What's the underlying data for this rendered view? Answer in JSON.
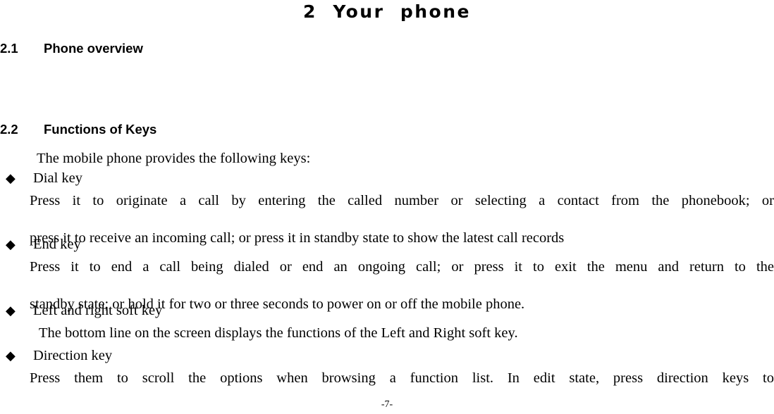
{
  "document": {
    "chapter_title": "2  Your  phone",
    "footer_page_number": "-7-"
  },
  "sections": {
    "overview": {
      "number": "2.1",
      "title": "Phone overview",
      "body": ""
    },
    "functions": {
      "number": "2.2",
      "title": "Functions of Keys",
      "intro": "The mobile phone provides the following keys:"
    }
  },
  "bullets": {
    "marker": "◆",
    "dial": {
      "label": "Dial key",
      "line1": "Press it to originate a call by entering the called number or selecting a contact from the phonebook; or",
      "line2": "press it to receive an incoming call; or press it in standby state to show the latest call records"
    },
    "end": {
      "label": "End key",
      "line1": "Press it to end a call being dialed or end an ongoing call; or press it to exit the menu and return to the",
      "line2": "standby state; or hold it for two or three seconds to power on or off the mobile phone."
    },
    "soft": {
      "label": "Left and right soft key",
      "line1": "The bottom line on the screen displays the functions of the Left and Right soft key."
    },
    "direction": {
      "label": "Direction key",
      "line1": "Press them to scroll the options when browsing a function list. In edit state, press direction keys to"
    }
  }
}
